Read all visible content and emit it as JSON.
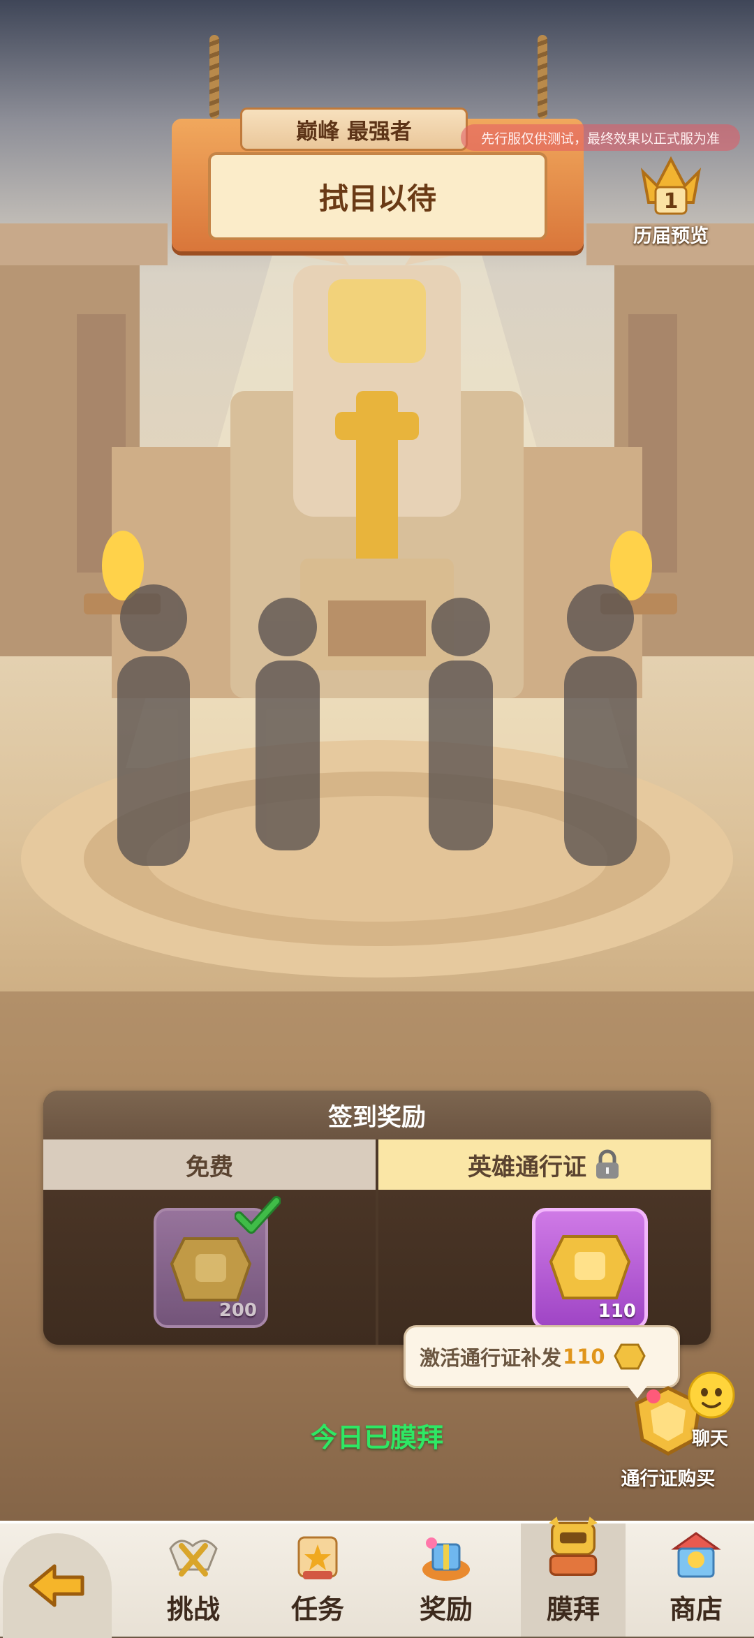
{
  "signboard": {
    "title": "巅峰 最强者",
    "status": "拭目以待",
    "notice": "先行服仅供测试，最终效果以正式服为准"
  },
  "history_preview": {
    "rank": "1",
    "label": "历届预览"
  },
  "rewards": {
    "title": "签到奖励",
    "free": {
      "label": "免费",
      "quantity": "200",
      "claimed": true
    },
    "pass": {
      "label": "英雄通行证",
      "quantity": "110",
      "locked": true
    }
  },
  "tooltip": {
    "text": "激活通行证补发",
    "amount": "110"
  },
  "status_text": "今日已膜拜",
  "pass_buy": {
    "label": "通行证购买"
  },
  "chat": {
    "label": "聊天"
  },
  "nav": {
    "tabs": [
      {
        "label": "挑战",
        "icon": "wings-swords-icon"
      },
      {
        "label": "任务",
        "icon": "scroll-star-icon"
      },
      {
        "label": "奖励",
        "icon": "gift-box-icon"
      },
      {
        "label": "膜拜",
        "icon": "golden-statue-icon",
        "active": true
      },
      {
        "label": "商店",
        "icon": "shop-icon"
      }
    ]
  },
  "colors": {
    "accent_green": "#2ee864",
    "pass_purple": "#b24fd6",
    "gold": "#e0951b"
  }
}
